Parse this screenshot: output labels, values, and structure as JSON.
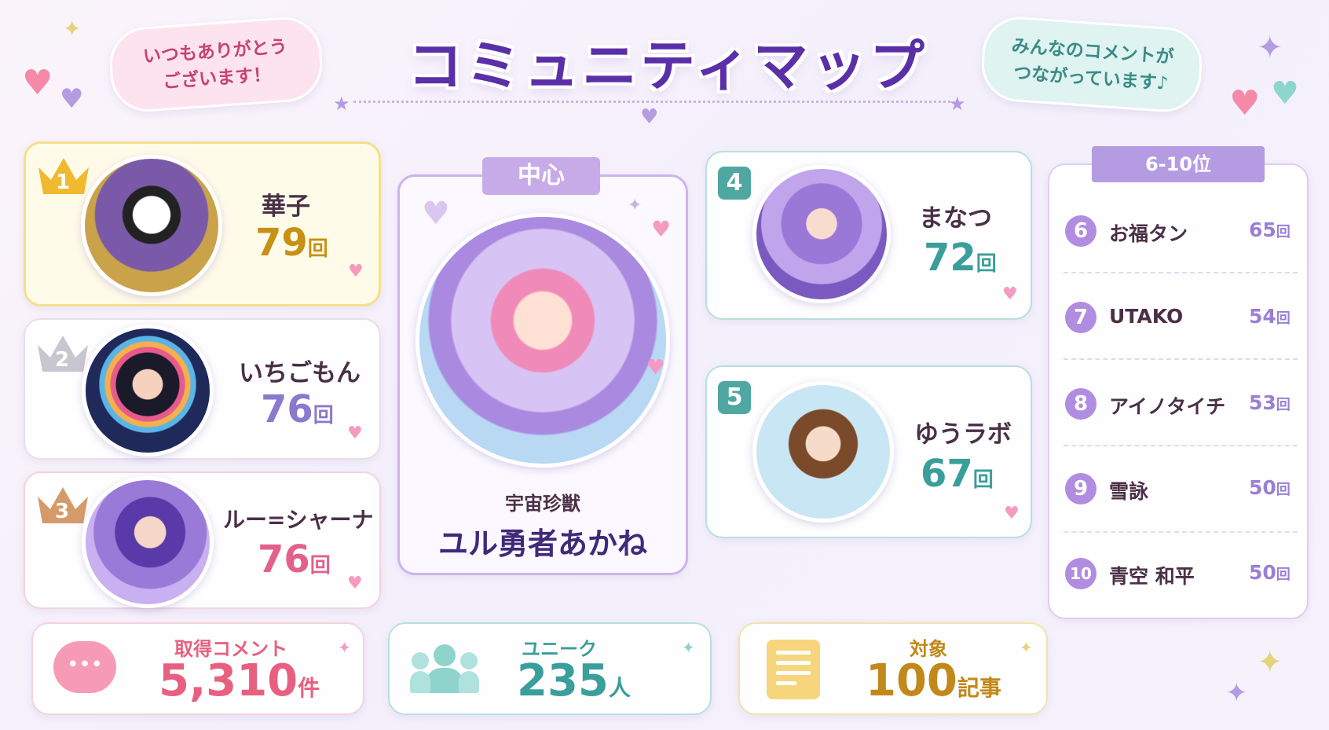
{
  "header": {
    "title": "コミュニティマップ",
    "bubble_left": "いつもありがとう\nございます！",
    "bubble_right": "みんなのコメントが\nつながっています♪"
  },
  "top3": [
    {
      "rank": "1",
      "name": "華子",
      "count": "79",
      "unit": "回"
    },
    {
      "rank": "2",
      "name": "いちごもん",
      "count": "76",
      "unit": "回"
    },
    {
      "rank": "3",
      "name": "ルー=シャーナ",
      "count": "76",
      "unit": "回"
    }
  ],
  "center": {
    "tag": "中心",
    "subtitle": "宇宙珍獣",
    "name": "ユル勇者あかね"
  },
  "mid": [
    {
      "rank": "4",
      "name": "まなつ",
      "count": "72",
      "unit": "回"
    },
    {
      "rank": "5",
      "name": "ゆうラボ",
      "count": "67",
      "unit": "回"
    }
  ],
  "side": {
    "header": "6-10位",
    "items": [
      {
        "rank": "6",
        "name": "お福タン",
        "count": "65",
        "unit": "回"
      },
      {
        "rank": "7",
        "name": "UTAKO",
        "count": "54",
        "unit": "回"
      },
      {
        "rank": "8",
        "name": "アイノタイチ",
        "count": "53",
        "unit": "回"
      },
      {
        "rank": "9",
        "name": "雪詠",
        "count": "50",
        "unit": "回"
      },
      {
        "rank": "10",
        "name": "青空 和平",
        "count": "50",
        "unit": "回"
      }
    ]
  },
  "stats": [
    {
      "label": "取得コメント",
      "value": "5,310",
      "unit": "件",
      "color": "#e8607f"
    },
    {
      "label": "ユニーク",
      "value": "235",
      "unit": "人",
      "color": "#3a9e9a"
    },
    {
      "label": "対象",
      "value": "100",
      "unit": "記事",
      "color": "#c2881a"
    }
  ],
  "colors": {
    "gold": "#f0b92e",
    "silver": "#c8c6d0",
    "bronze": "#d49a6a",
    "teal": "#4fa7a2",
    "purple": "#b08de0"
  }
}
